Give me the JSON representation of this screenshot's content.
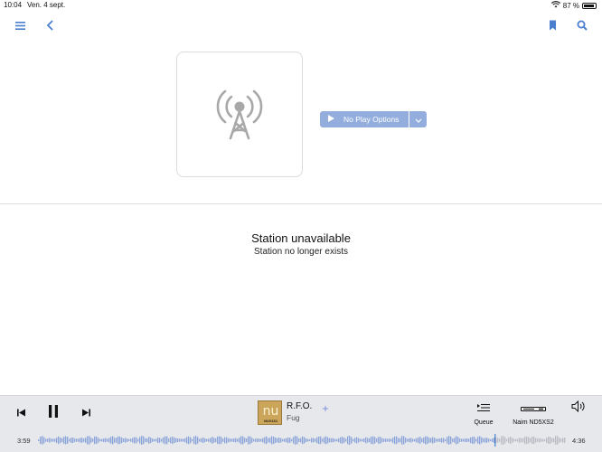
{
  "status_bar": {
    "time": "10:04",
    "date": "Ven. 4 sept.",
    "battery": "87 %"
  },
  "station": {
    "play_button_label": "No Play Options",
    "message_title": "Station unavailable",
    "message_subtitle": "Station no longer exists"
  },
  "player": {
    "track_title": "R.F.O.",
    "track_artist": "Fug",
    "cover_text": "nu",
    "cover_code": "NUX161",
    "queue_label": "Queue",
    "device_label": "Naim ND5XS2",
    "time_elapsed": "3:59",
    "time_total": "4:36",
    "progress": 0.865
  },
  "colors": {
    "accent": "#4a7fd0",
    "button": "#93aedd",
    "waveform_played": "#8aa3d8",
    "waveform_remaining": "#b9bcc2"
  }
}
